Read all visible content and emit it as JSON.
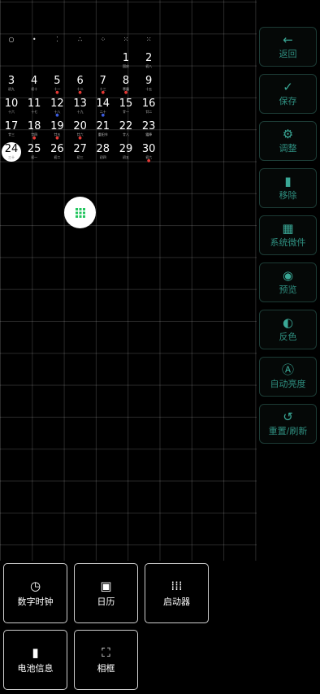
{
  "calendar": {
    "moon_phases": [
      "○",
      "•",
      "⁚",
      "∴",
      "⁘",
      "⁙",
      "⁙"
    ],
    "weeks": [
      [
        null,
        null,
        null,
        null,
        null,
        {
          "d": "1",
          "s": "国庆",
          "m": ""
        },
        {
          "d": "2",
          "s": "初八",
          "m": ""
        }
      ],
      [
        {
          "d": "3",
          "s": "初九",
          "m": ""
        },
        {
          "d": "4",
          "s": "初十",
          "m": ""
        },
        {
          "d": "5",
          "s": "十一",
          "m": "red"
        },
        {
          "d": "6",
          "s": "十二",
          "m": "red"
        },
        {
          "d": "7",
          "s": "十三",
          "m": "red"
        },
        {
          "d": "8",
          "s": "寒露",
          "m": "red"
        },
        {
          "d": "9",
          "s": "十五",
          "m": ""
        }
      ],
      [
        {
          "d": "10",
          "s": "十六",
          "m": ""
        },
        {
          "d": "11",
          "s": "十七",
          "m": ""
        },
        {
          "d": "12",
          "s": "十八",
          "m": "blue"
        },
        {
          "d": "13",
          "s": "十九",
          "m": ""
        },
        {
          "d": "14",
          "s": "二十",
          "m": "blue"
        },
        {
          "d": "15",
          "s": "廿一",
          "m": ""
        },
        {
          "d": "16",
          "s": "廿二",
          "m": ""
        }
      ],
      [
        {
          "d": "17",
          "s": "廿三",
          "m": ""
        },
        {
          "d": "18",
          "s": "廿四",
          "m": "red"
        },
        {
          "d": "19",
          "s": "廿五",
          "m": "red"
        },
        {
          "d": "20",
          "s": "廿六",
          "m": "red"
        },
        {
          "d": "21",
          "s": "重阳节",
          "m": ""
        },
        {
          "d": "22",
          "s": "廿八",
          "m": ""
        },
        {
          "d": "23",
          "s": "霜降",
          "m": ""
        }
      ],
      [
        {
          "d": "24",
          "s": "三十",
          "m": "",
          "today": true
        },
        {
          "d": "25",
          "s": "初一",
          "m": ""
        },
        {
          "d": "26",
          "s": "初二",
          "m": ""
        },
        {
          "d": "27",
          "s": "初三",
          "m": ""
        },
        {
          "d": "28",
          "s": "初四",
          "m": ""
        },
        {
          "d": "29",
          "s": "初五",
          "m": ""
        },
        {
          "d": "30",
          "s": "初六",
          "m": "red"
        }
      ]
    ]
  },
  "sidebar": [
    {
      "icon": "arrow-left-icon",
      "glyph": "←",
      "label": "返回"
    },
    {
      "icon": "check-icon",
      "glyph": "✓",
      "label": "保存"
    },
    {
      "icon": "gear-icon",
      "glyph": "⚙",
      "label": "调整"
    },
    {
      "icon": "trash-icon",
      "glyph": "▮",
      "label": "移除"
    },
    {
      "icon": "widgets-icon",
      "glyph": "▦",
      "label": "系统微件"
    },
    {
      "icon": "eye-icon",
      "glyph": "◉",
      "label": "预览"
    },
    {
      "icon": "contrast-icon",
      "glyph": "◐",
      "label": "反色"
    },
    {
      "icon": "auto-brightness-icon",
      "glyph": "Ⓐ",
      "label": "自动亮度"
    },
    {
      "icon": "reset-icon",
      "glyph": "↺",
      "label": "重置/刷新"
    }
  ],
  "tiles": [
    {
      "icon": "clock-icon",
      "glyph": "◷",
      "label": "数字时钟"
    },
    {
      "icon": "calendar-icon",
      "glyph": "▣",
      "label": "日历"
    },
    {
      "icon": "grid-icon",
      "glyph": "⁞⁞⁞",
      "label": "启动器"
    },
    {
      "icon": "battery-icon",
      "glyph": "▮",
      "label": "电池信息"
    },
    {
      "icon": "frame-icon",
      "glyph": "⛶",
      "label": "相框"
    }
  ],
  "colors": {
    "accent": "#2f8f80",
    "red_marker": "#e53935",
    "blue_marker": "#3b5bdb",
    "fab_icon": "#22c55e"
  }
}
